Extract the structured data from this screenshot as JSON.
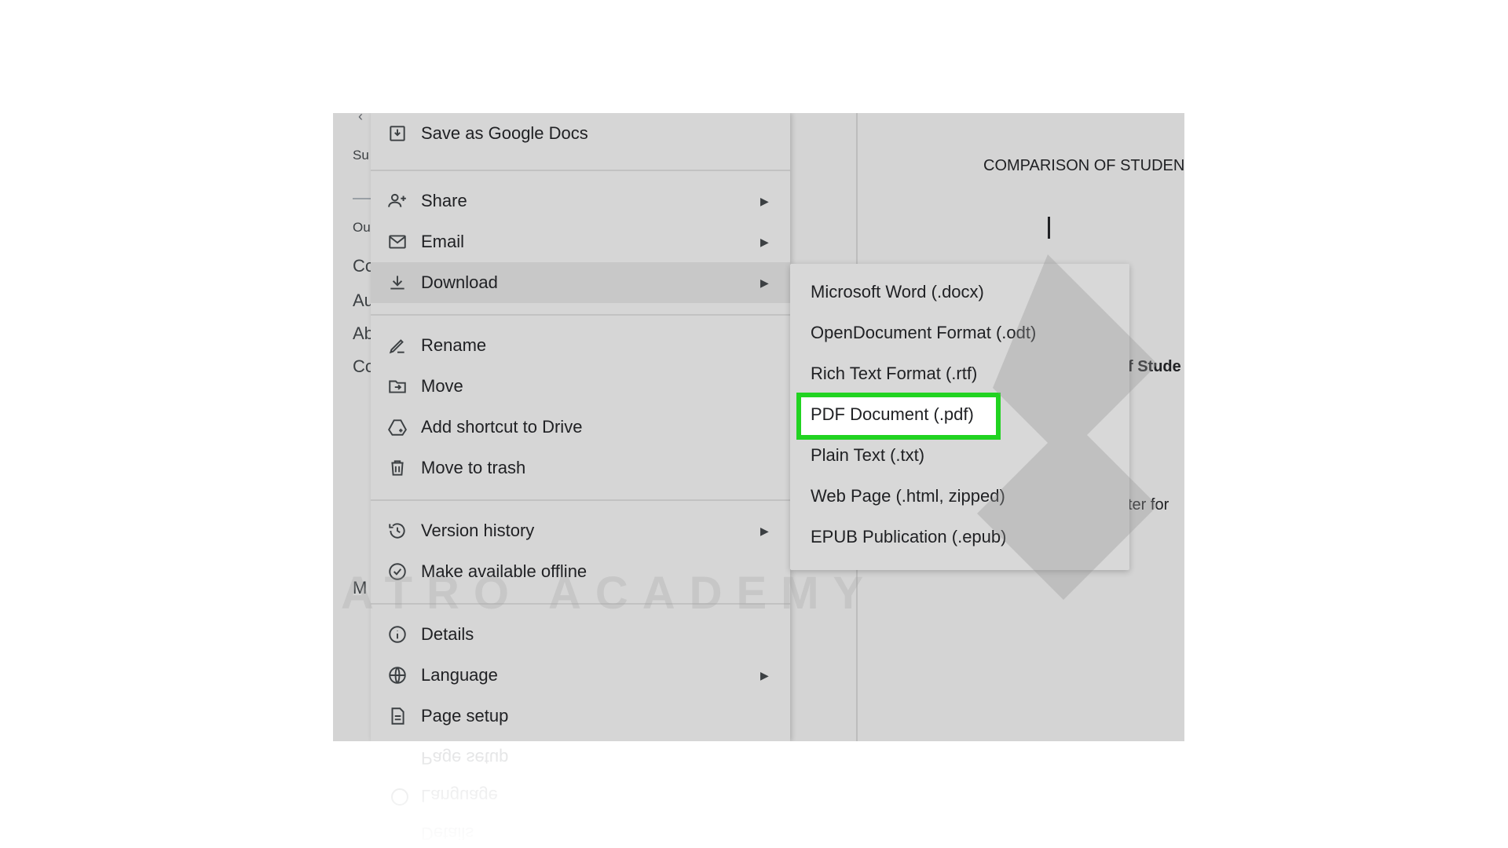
{
  "outline": {
    "fragments": [
      "Su",
      "Ou",
      "Co",
      "Au",
      "Ab",
      "Co",
      "M"
    ]
  },
  "document": {
    "title": "COMPARISON OF STUDEN",
    "fragment_1": "f Stude",
    "fragment_2": "ter for"
  },
  "file_menu": {
    "items": [
      {
        "label": "Save as Google Docs",
        "icon": "save-docs-icon",
        "has_submenu": false
      },
      {
        "label": "Share",
        "icon": "share-person-icon",
        "has_submenu": true
      },
      {
        "label": "Email",
        "icon": "envelope-icon",
        "has_submenu": true
      },
      {
        "label": "Download",
        "icon": "download-icon",
        "has_submenu": true,
        "highlighted": true
      },
      {
        "label": "Rename",
        "icon": "rename-pencil-icon",
        "has_submenu": false
      },
      {
        "label": "Move",
        "icon": "move-folder-icon",
        "has_submenu": false
      },
      {
        "label": "Add shortcut to Drive",
        "icon": "drive-shortcut-icon",
        "has_submenu": false
      },
      {
        "label": "Move to trash",
        "icon": "trash-icon",
        "has_submenu": false
      },
      {
        "label": "Version history",
        "icon": "history-icon",
        "has_submenu": true
      },
      {
        "label": "Make available offline",
        "icon": "offline-check-icon",
        "has_submenu": false
      },
      {
        "label": "Details",
        "icon": "info-icon",
        "has_submenu": false
      },
      {
        "label": "Language",
        "icon": "globe-icon",
        "has_submenu": true
      },
      {
        "label": "Page setup",
        "icon": "page-icon",
        "has_submenu": false
      }
    ],
    "submenu_arrow": "▶"
  },
  "download_submenu": {
    "items": [
      {
        "label": "Microsoft Word (.docx)"
      },
      {
        "label": "OpenDocument Format (.odt)"
      },
      {
        "label": "Rich Text Format (.rtf)"
      },
      {
        "label": "PDF Document (.pdf)",
        "selected": true
      },
      {
        "label": "Plain Text (.txt)"
      },
      {
        "label": "Web Page (.html, zipped)"
      },
      {
        "label": "EPUB Publication (.epub)"
      }
    ],
    "selected_outline_color": "#21d321"
  },
  "watermark": {
    "text": "ATRO ACADEMY"
  },
  "reflection": {
    "items": [
      "Page setup",
      "Language",
      "Details"
    ]
  },
  "colors": {
    "backdrop": "#d4d4d4",
    "menu_bg": "#d6d6d6",
    "highlight_bg": "#c8c8c8",
    "selection_box": "#21d321"
  }
}
